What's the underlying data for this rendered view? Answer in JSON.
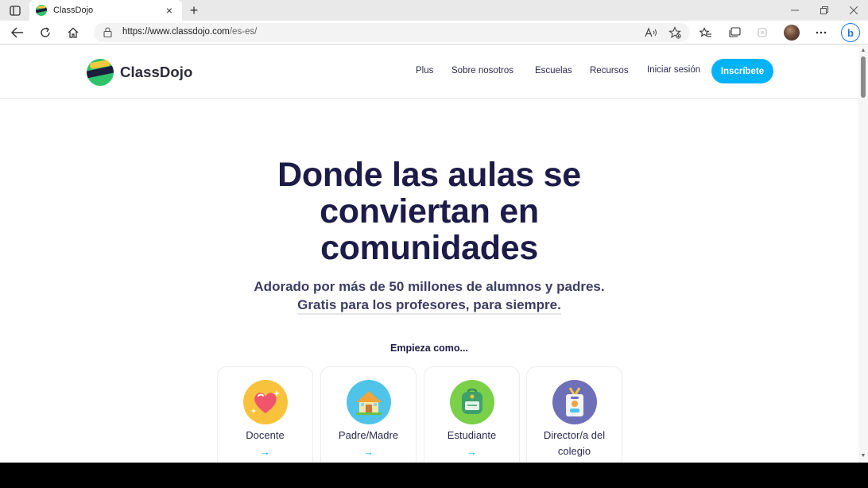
{
  "browser": {
    "tab_title": "ClassDojo",
    "new_tab": "+",
    "tab_close": "×",
    "url_host": "https://www.classdojo.com",
    "url_path": "/es-es/",
    "bing_label": "b"
  },
  "site": {
    "brand": "ClassDojo",
    "nav": [
      "Plus",
      "Sobre nosotros",
      "Escuelas",
      "Recursos",
      "Iniciar sesión"
    ],
    "signup": "Inscríbete"
  },
  "hero": {
    "title_line1": "Donde las aulas se",
    "title_line2": "conviertan en",
    "title_line3": "comunidades",
    "sub_line1": "Adorado por más de 50 millones de alumnos y padres.",
    "sub_line2": "Gratis para los profesores, para siempre.",
    "start_as": "Empieza como..."
  },
  "cards": [
    {
      "label": "Docente",
      "arrow": "→",
      "icon": "heart-icon",
      "color": "#f9c23c"
    },
    {
      "label": "Padre/Madre",
      "arrow": "→",
      "icon": "house-icon",
      "color": "#4fc3e8"
    },
    {
      "label": "Estudiante",
      "arrow": "→",
      "icon": "backpack-icon",
      "color": "#7bd04a"
    },
    {
      "label_line1": "Director/a del",
      "label_line2": "colegio",
      "icon": "badge-icon",
      "color": "#6d6fb8"
    }
  ],
  "colors": {
    "accent": "#00b2f7",
    "title": "#1d1b48",
    "brand_green": "#2fc26b"
  }
}
